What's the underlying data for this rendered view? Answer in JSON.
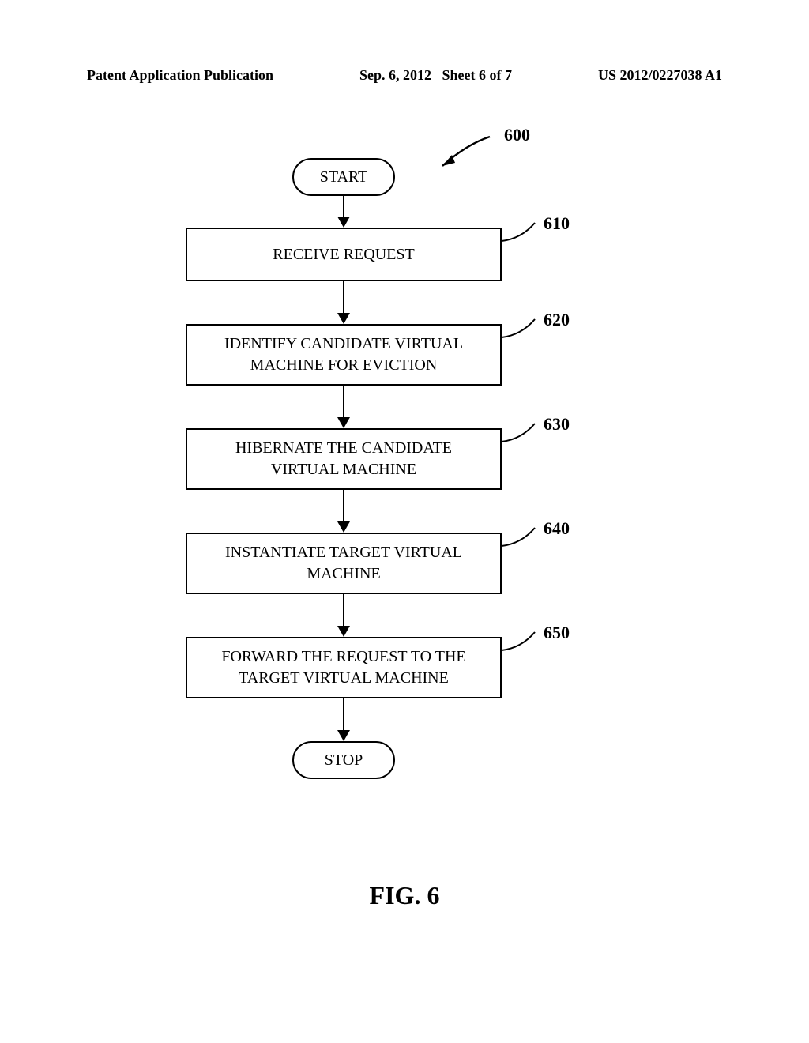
{
  "header": {
    "left": "Patent Application Publication",
    "center_date": "Sep. 6, 2012",
    "center_sheet": "Sheet 6 of 7",
    "right": "US 2012/0227038 A1"
  },
  "flowchart": {
    "figure_ref": "600",
    "start": "START",
    "stop": "STOP",
    "steps": [
      {
        "ref": "610",
        "text": "RECEIVE REQUEST"
      },
      {
        "ref": "620",
        "text": "IDENTIFY CANDIDATE VIRTUAL\nMACHINE FOR EVICTION"
      },
      {
        "ref": "630",
        "text": "HIBERNATE THE CANDIDATE\nVIRTUAL MACHINE"
      },
      {
        "ref": "640",
        "text": "INSTANTIATE TARGET VIRTUAL\nMACHINE"
      },
      {
        "ref": "650",
        "text": "FORWARD THE REQUEST TO THE\nTARGET VIRTUAL MACHINE"
      }
    ],
    "figure_label": "FIG. 6"
  }
}
